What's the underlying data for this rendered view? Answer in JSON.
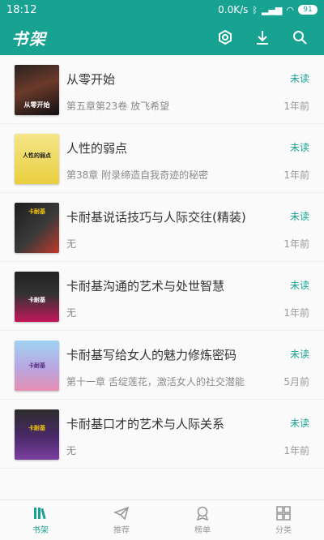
{
  "status_bar": {
    "time": "18:12",
    "network_speed": "0.0K/s",
    "battery": "91"
  },
  "app_bar": {
    "title": "书架",
    "icons": [
      "settings-icon",
      "download-icon",
      "search-icon"
    ]
  },
  "books": [
    {
      "title": "从零开始",
      "progress": "第五章第23卷 放飞希望",
      "status": "未读",
      "time": "1年前",
      "cover_text": "从零开始"
    },
    {
      "title": "人性的弱点",
      "progress": "第38章 附录缔造自我奇迹的秘密",
      "status": "未读",
      "time": "1年前",
      "cover_text": "人性的弱点"
    },
    {
      "title": "卡耐基说话技巧与人际交往(精装)",
      "progress": "无",
      "status": "未读",
      "time": "1年前",
      "cover_text": "卡耐基"
    },
    {
      "title": "卡耐基沟通的艺术与处世智慧",
      "progress": "无",
      "status": "未读",
      "time": "1年前",
      "cover_text": "卡耐基"
    },
    {
      "title": "卡耐基写给女人的魅力修炼密码",
      "progress": "第十一章 舌绽莲花，激活女人的社交潜能",
      "status": "未读",
      "time": "5月前",
      "cover_text": "卡耐基"
    },
    {
      "title": "卡耐基口才的艺术与人际关系",
      "progress": "无",
      "status": "未读",
      "time": "1年前",
      "cover_text": "卡耐基"
    }
  ],
  "tabs": [
    {
      "label": "书架",
      "icon": "bookshelf-icon",
      "active": true
    },
    {
      "label": "推荐",
      "icon": "paper-plane-icon",
      "active": false
    },
    {
      "label": "榜单",
      "icon": "badge-icon",
      "active": false
    },
    {
      "label": "分类",
      "icon": "grid-icon",
      "active": false
    }
  ],
  "colors": {
    "accent": "#18a292"
  }
}
